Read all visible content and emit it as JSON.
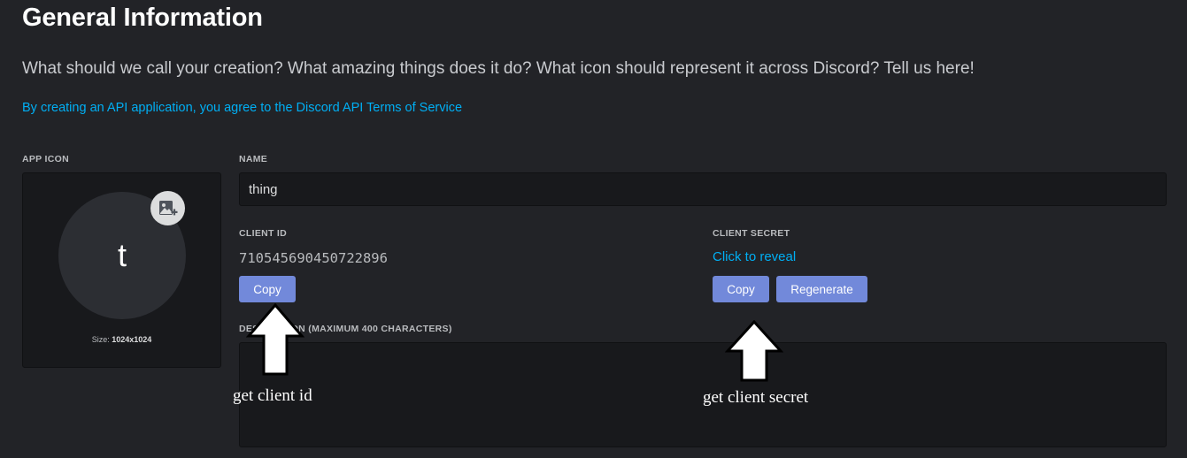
{
  "header": {
    "title": "General Information",
    "subtitle": "What should we call your creation? What amazing things does it do? What icon should represent it across Discord? Tell us here!",
    "tos_link": "By creating an API application, you agree to the Discord API Terms of Service"
  },
  "app_icon": {
    "label": "APP ICON",
    "letter": "t",
    "size_label": "Size:",
    "size_value": "1024x1024",
    "upload_icon": "image-add-icon"
  },
  "name_field": {
    "label": "NAME",
    "value": "thing"
  },
  "client_id": {
    "label": "CLIENT ID",
    "value": "710545690450722896",
    "copy_label": "Copy"
  },
  "client_secret": {
    "label": "CLIENT SECRET",
    "reveal_label": "Click to reveal",
    "copy_label": "Copy",
    "regenerate_label": "Regenerate"
  },
  "description": {
    "label": "DESCRIPTION (MAXIMUM 400 CHARACTERS)",
    "value": ""
  },
  "annotations": {
    "client_id_note": "get client id",
    "client_secret_note": "get client secret",
    "arrow_icon": "up-arrow-icon"
  },
  "colors": {
    "background": "#222327",
    "button": "#7289da",
    "link": "#00aff4",
    "input_background": "#18191c"
  }
}
